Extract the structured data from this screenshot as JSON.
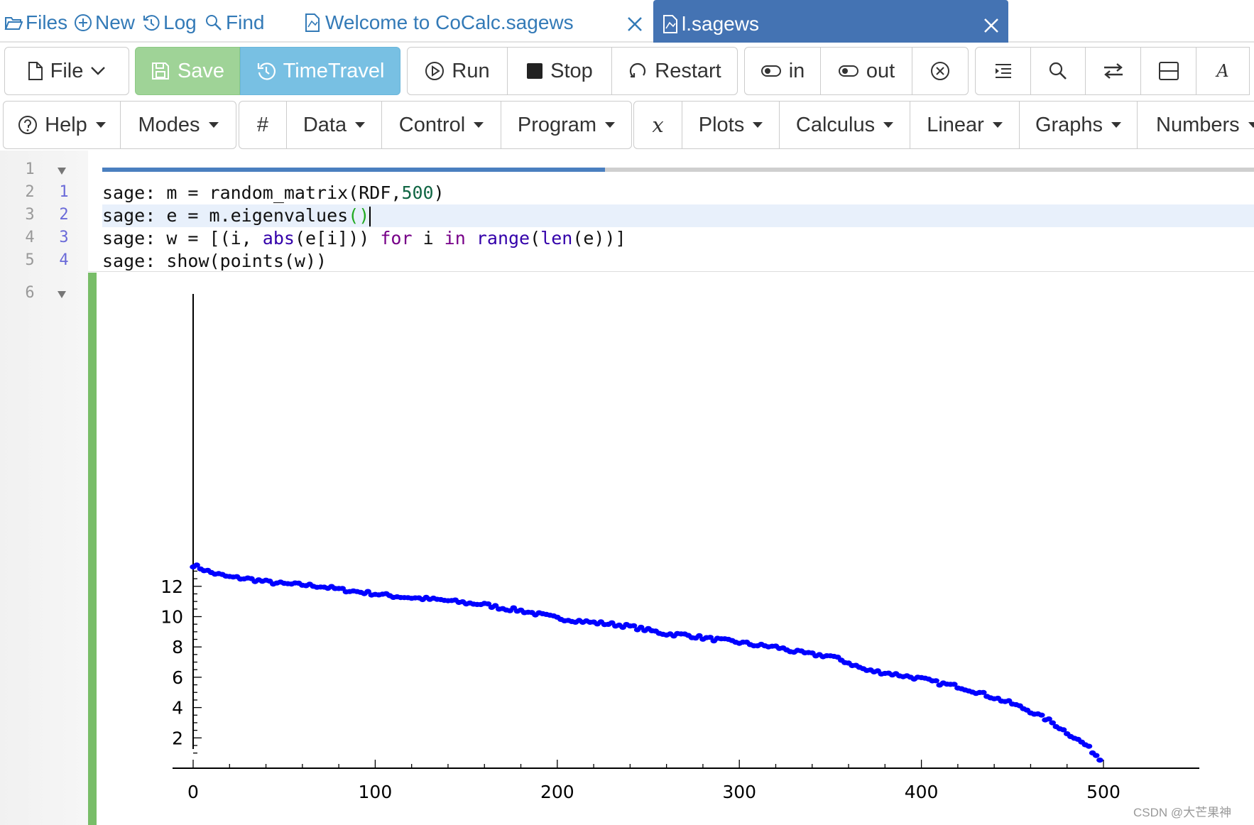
{
  "topnav": {
    "files": "Files",
    "new": "New",
    "log": "Log",
    "find": "Find",
    "tab_inactive": "Welcome to CoCalc.sagews",
    "tab_active": "l.sagews"
  },
  "toolbar1": {
    "file": "File",
    "save": "Save",
    "timetravel": "TimeTravel",
    "run": "Run",
    "stop": "Stop",
    "restart": "Restart",
    "zoom_in": "in",
    "zoom_out": "out",
    "font_label": "A"
  },
  "toolbar2": {
    "help": "Help",
    "modes": "Modes",
    "hash": "#",
    "data": "Data",
    "control": "Control",
    "program": "Program",
    "x": "x",
    "plots": "Plots",
    "calculus": "Calculus",
    "linear": "Linear",
    "graphs": "Graphs",
    "numbers": "Numbers"
  },
  "gutter": {
    "line_numbers": [
      "1",
      "2",
      "3",
      "4",
      "5",
      "6"
    ],
    "input_numbers": [
      "1",
      "2",
      "3",
      "4"
    ]
  },
  "code": {
    "prompt": "sage: ",
    "line1": {
      "a": "m = random_matrix(RDF,",
      "num": "500",
      "b": ")"
    },
    "line2": {
      "a": "e = m.eigenvalues",
      "paren": "()"
    },
    "line3": {
      "a": "w = [(i, ",
      "abs": "abs",
      "b": "(e[i])) ",
      "for": "for",
      "c": " i ",
      "in": "in",
      "d": " ",
      "range": "range",
      "e": "(",
      "len": "len",
      "f": "(e))]"
    },
    "line4": {
      "a": "show(points(w))"
    }
  },
  "colors": {
    "active_tab": "#4473b3",
    "link": "#337ab7",
    "save": "#9fd397",
    "timetravel": "#78c0e3",
    "output_bar": "#78bd68",
    "points": "#0000ff"
  },
  "chart_data": {
    "type": "scatter",
    "title": "",
    "xlabel": "",
    "ylabel": "",
    "xlim": [
      0,
      500
    ],
    "ylim": [
      0,
      13.5
    ],
    "xticks": [
      "0",
      "100",
      "200",
      "300",
      "400",
      "500"
    ],
    "yticks": [
      "2",
      "4",
      "6",
      "8",
      "10",
      "12"
    ],
    "grid": false,
    "legend": "none",
    "marker_color": "#0000ff",
    "curve": [
      [
        0,
        13.4
      ],
      [
        10,
        12.9
      ],
      [
        20,
        12.6
      ],
      [
        30,
        12.5
      ],
      [
        40,
        12.3
      ],
      [
        50,
        12.15
      ],
      [
        60,
        12.1
      ],
      [
        70,
        12.0
      ],
      [
        80,
        11.8
      ],
      [
        90,
        11.65
      ],
      [
        100,
        11.5
      ],
      [
        110,
        11.35
      ],
      [
        120,
        11.25
      ],
      [
        130,
        11.15
      ],
      [
        140,
        11.05
      ],
      [
        150,
        10.9
      ],
      [
        160,
        10.8
      ],
      [
        170,
        10.55
      ],
      [
        180,
        10.4
      ],
      [
        190,
        10.15
      ],
      [
        200,
        9.9
      ],
      [
        210,
        9.75
      ],
      [
        220,
        9.6
      ],
      [
        230,
        9.5
      ],
      [
        240,
        9.35
      ],
      [
        250,
        9.1
      ],
      [
        260,
        8.85
      ],
      [
        270,
        8.8
      ],
      [
        280,
        8.6
      ],
      [
        290,
        8.45
      ],
      [
        300,
        8.3
      ],
      [
        310,
        8.1
      ],
      [
        320,
        8.0
      ],
      [
        330,
        7.7
      ],
      [
        340,
        7.5
      ],
      [
        350,
        7.4
      ],
      [
        360,
        6.95
      ],
      [
        370,
        6.45
      ],
      [
        380,
        6.3
      ],
      [
        390,
        6.1
      ],
      [
        400,
        5.9
      ],
      [
        410,
        5.6
      ],
      [
        420,
        5.4
      ],
      [
        430,
        5.05
      ],
      [
        440,
        4.65
      ],
      [
        450,
        4.25
      ],
      [
        460,
        3.75
      ],
      [
        470,
        3.15
      ],
      [
        480,
        2.35
      ],
      [
        490,
        1.55
      ],
      [
        495,
        1.0
      ],
      [
        500,
        0.3
      ]
    ],
    "points_n": 250,
    "points_step": 2,
    "jitter": 0.12
  },
  "watermark": "CSDN @大芒果神"
}
